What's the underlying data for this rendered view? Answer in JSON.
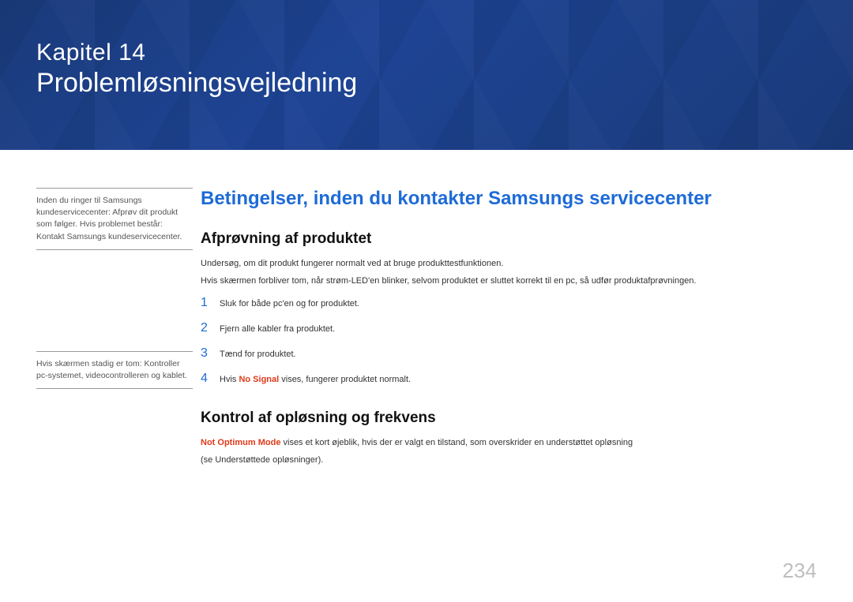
{
  "header": {
    "chapter_label": "Kapitel  14",
    "chapter_title": "Problemløsningsvejledning"
  },
  "sidebar": {
    "note1": "Inden du ringer til Samsungs kundeservicecenter: Afprøv dit produkt som følger. Hvis problemet består: Kontakt Samsungs kundeservicecenter.",
    "note2": "Hvis skærmen stadig er tom: Kontroller pc-systemet, videocontrolleren og kablet."
  },
  "main": {
    "h_blue": "Betingelser, inden du kontakter Samsungs servicecenter",
    "section1": {
      "heading": "Afprøvning af produktet",
      "para1": "Undersøg, om dit produkt fungerer normalt ved at bruge produkttestfunktionen.",
      "para2": "Hvis skærmen forbliver tom, når strøm-LED'en blinker, selvom produktet er sluttet korrekt til en pc, så udfør produktafprøvningen.",
      "steps": [
        {
          "n": "1",
          "text": "Sluk for både pc'en og for produktet."
        },
        {
          "n": "2",
          "text": "Fjern alle kabler fra produktet."
        },
        {
          "n": "3",
          "text": "Tænd for produktet."
        },
        {
          "n": "4",
          "prefix": "Hvis ",
          "bold": "No Signal",
          "suffix": " vises, fungerer produktet normalt."
        }
      ]
    },
    "section2": {
      "heading": "Kontrol af opløsning og frekvens",
      "bold": "Not Optimum Mode",
      "after_bold": " vises et kort øjeblik, hvis der er valgt en tilstand, som overskrider en understøttet opløsning",
      "line2": "(se Understøttede opløsninger)."
    }
  },
  "page_number": "234"
}
